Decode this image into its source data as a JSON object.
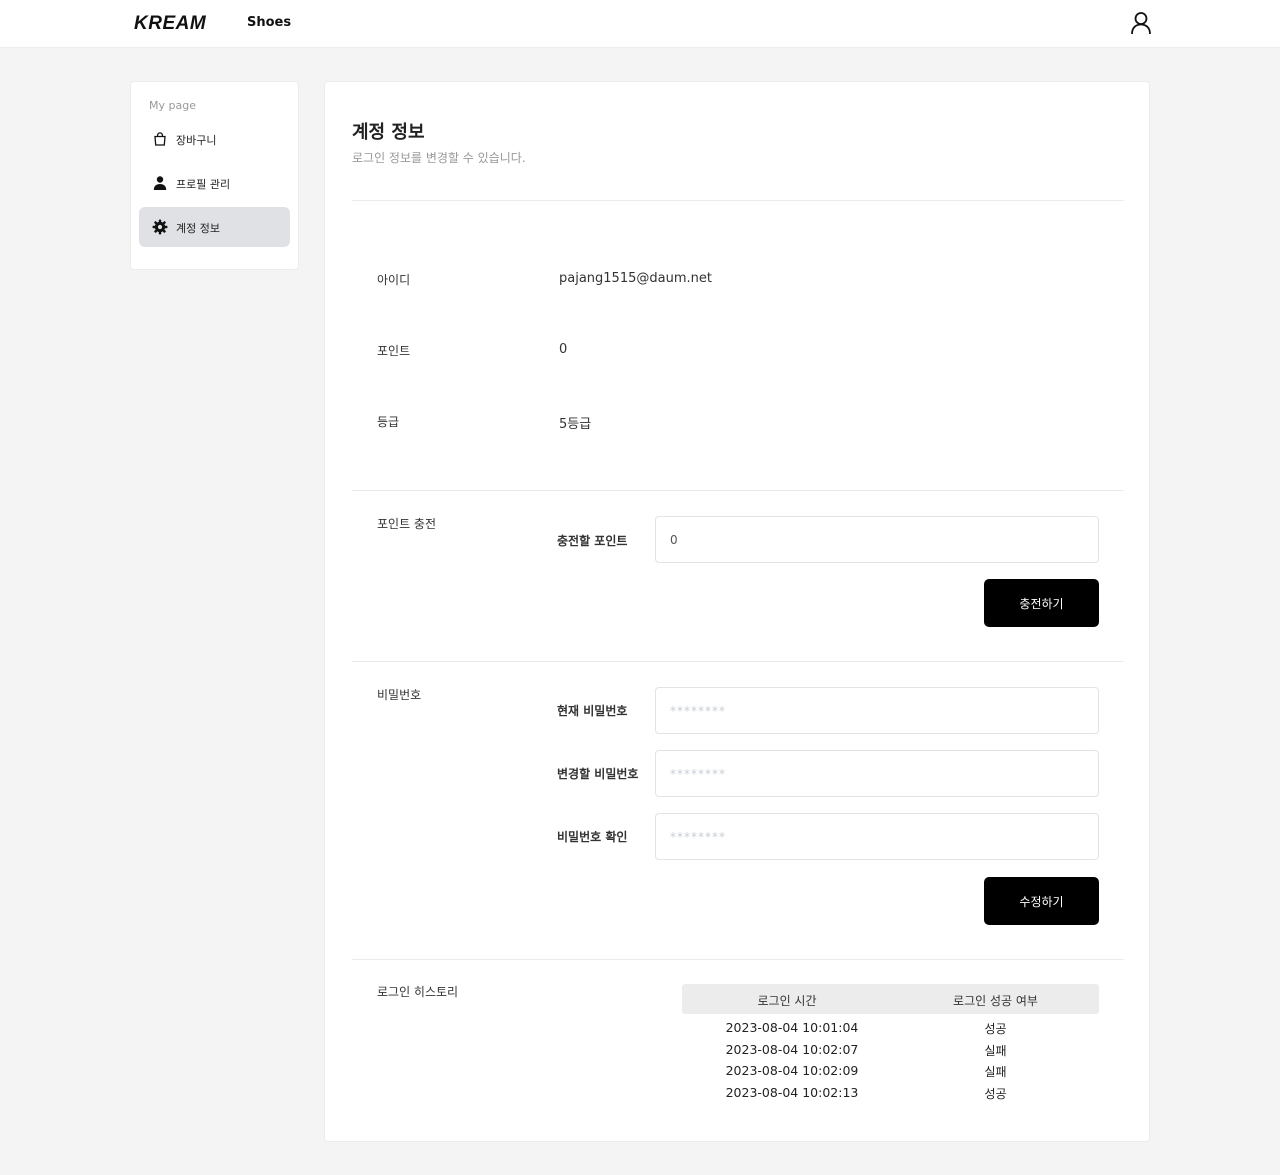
{
  "header": {
    "logo": "KREAM",
    "nav_shoes": "Shoes",
    "user_icon": "user-icon"
  },
  "sidebar": {
    "title": "My page",
    "items": [
      {
        "label": "장바구니",
        "icon": "shopping-bag-icon",
        "active": false
      },
      {
        "label": "프로필 관리",
        "icon": "person-icon",
        "active": false
      },
      {
        "label": "계정 정보",
        "icon": "gear-icon",
        "active": true
      }
    ]
  },
  "main": {
    "title": "계정 정보",
    "subtitle": "로그인 정보를 변경할 수 있습니다.",
    "info": [
      {
        "label": "아이디",
        "value": "pajang1515@daum.net"
      },
      {
        "label": "포인트",
        "value": "0"
      },
      {
        "label": "등급",
        "value": "5등급"
      }
    ],
    "charge": {
      "section_label": "포인트 충전",
      "field_label": "충전할 포인트",
      "field_value": "0",
      "button": "충전하기"
    },
    "password": {
      "section_label": "비밀번호",
      "fields": [
        {
          "label": "현재 비밀번호",
          "placeholder": "********"
        },
        {
          "label": "변경할 비밀번호",
          "placeholder": "********"
        },
        {
          "label": "비밀번호 확인",
          "placeholder": "********"
        }
      ],
      "button": "수정하기"
    },
    "history": {
      "section_label": "로그인 히스토리",
      "columns": [
        "로그인 시간",
        "로그인 성공 여부"
      ],
      "rows": [
        {
          "time": "2023-08-04 10:01:04",
          "result": "성공"
        },
        {
          "time": "2023-08-04 10:02:07",
          "result": "실패"
        },
        {
          "time": "2023-08-04 10:02:09",
          "result": "실패"
        },
        {
          "time": "2023-08-04 10:02:13",
          "result": "성공"
        }
      ]
    }
  }
}
